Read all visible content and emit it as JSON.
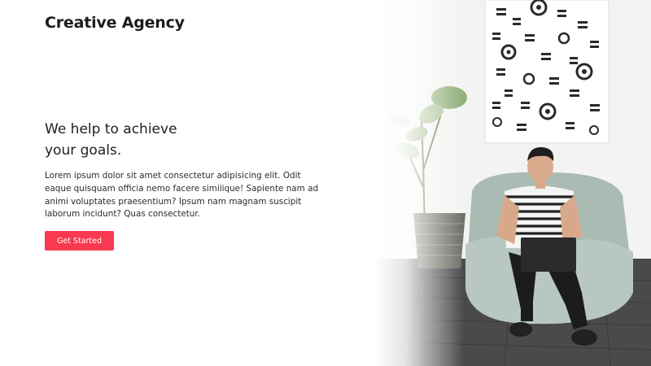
{
  "header": {
    "brand": "Creative Agency",
    "menu_icon": "hamburger-menu-icon"
  },
  "hero": {
    "headline_line1": "We help to achieve",
    "headline_line2": "your goals.",
    "body": "Lorem ipsum dolor sit amet consectetur adipisicing elit. Odit eaque quisquam officia nemo facere similique! Sapiente nam ad animi voluptates praesentium? Ipsum nam magnam suscipit laborum incidunt? Quas consectetur.",
    "cta_label": "Get Started"
  },
  "colors": {
    "accent": "#f8394f",
    "text": "#1f1f1f",
    "background": "#ffffff"
  }
}
